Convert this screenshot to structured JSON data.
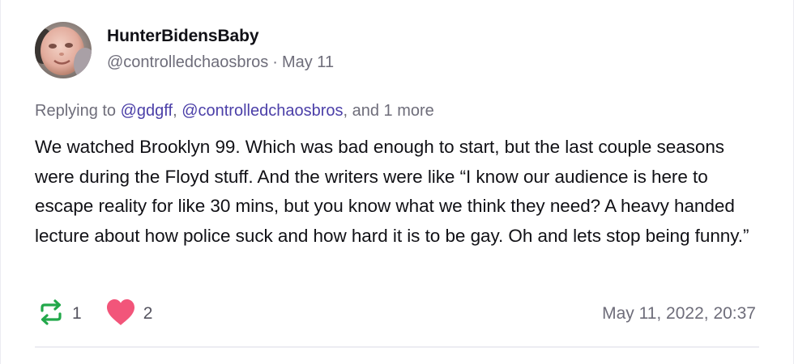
{
  "post": {
    "author": {
      "display_name": "HunterBidensBaby",
      "handle": "@controlledchaosbros",
      "date": "May 11"
    },
    "reply": {
      "prefix": "Replying to",
      "mention_1": "@gdgff",
      "separator": ",",
      "mention_2": "@controlledchaosbros",
      "suffix": ", and 1 more"
    },
    "text": "We watched Brooklyn 99. Which was bad enough to start, but the last couple seasons were during the Floyd stuff. And the writers were like “I know our audience is here to escape reality for like 30 mins, but you know what we think they need? A heavy handed lecture about how police suck and how hard it is to be gay. Oh and lets stop being funny.”",
    "reposts": "1",
    "likes": "2",
    "timestamp": "May 11, 2022, 20:37",
    "icons": {
      "repost": "repost-icon",
      "like": "heart-icon"
    },
    "colors": {
      "mention": "#4b3fa8",
      "repost": "#22a84a",
      "like": "#f2557a"
    }
  }
}
